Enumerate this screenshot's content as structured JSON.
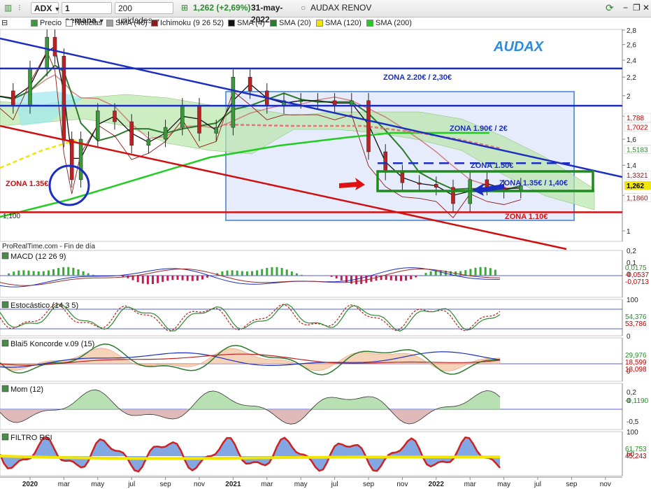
{
  "toolbar": {
    "ticker": "ADX",
    "timeframe": "1 semana",
    "units": "200 unidades",
    "price_change": "1,262 (+2,69%)",
    "date": "31-may-2022",
    "instrument": "AUDAX RENOV"
  },
  "legend": [
    {
      "label": "Precio",
      "color": "#3a9a3a",
      "icon": "candles-icon"
    },
    {
      "label": "Noticias",
      "color": "#ffffff",
      "icon": "news-icon"
    },
    {
      "label": "SMA (40)",
      "color": "#a0a0a0",
      "icon": "line-icon"
    },
    {
      "label": "Ichimoku (9 26 52)",
      "color": "#8b1a1a",
      "icon": "line-icon"
    },
    {
      "label": "SMA (4)",
      "color": "#111111",
      "icon": "line-icon"
    },
    {
      "label": "SMA (20)",
      "color": "#2d7a2d",
      "icon": "line-icon"
    },
    {
      "label": "SMA (120)",
      "color": "#f2e600",
      "icon": "line-icon"
    },
    {
      "label": "SMA (200)",
      "color": "#22cc22",
      "icon": "line-icon"
    }
  ],
  "chart_data": [
    {
      "type": "candlestick",
      "title": "AUDAX",
      "source": "ProRealTime.com - Fin de día",
      "x": [
        "2020-01",
        "2020-03",
        "2020-05",
        "2020-07",
        "2020-09",
        "2020-11",
        "2021-01",
        "2021-03",
        "2021-05",
        "2021-07",
        "2021-09",
        "2021-11",
        "2022-01",
        "2022-03",
        "2022-05",
        "2022-07",
        "2022-09",
        "2022-11"
      ],
      "x_tick_labels": [
        "2020",
        "mar",
        "may",
        "jul",
        "sep",
        "nov",
        "2021",
        "mar",
        "may",
        "jul",
        "sep",
        "nov",
        "2022",
        "mar",
        "may",
        "jul",
        "sep",
        "nov"
      ],
      "y_scale": "log",
      "ylim": [
        0.9,
        2.9
      ],
      "y_tick_labels": [
        "2,8",
        "2,6",
        "2,4",
        "2,2",
        "2",
        "1,8",
        "1,6",
        "1,4",
        "1,2",
        "1"
      ],
      "y_ticks": [
        2.8,
        2.6,
        2.4,
        2.2,
        2.0,
        1.8,
        1.6,
        1.4,
        1.2,
        1.0
      ],
      "price_x": [
        "2019-10",
        "2019-11",
        "2019-12",
        "2020-01",
        "2020-02",
        "2020-02-15",
        "2020-03",
        "2020-03-15",
        "2020-04",
        "2020-05",
        "2020-06",
        "2020-07",
        "2020-08",
        "2020-09",
        "2020-10",
        "2020-11",
        "2020-12",
        "2021-01",
        "2021-02",
        "2021-03",
        "2021-04",
        "2021-05",
        "2021-06",
        "2021-07",
        "2021-08",
        "2021-09",
        "2021-10",
        "2021-11",
        "2021-12",
        "2022-01",
        "2022-02",
        "2022-03",
        "2022-04",
        "2022-05",
        "2022-06"
      ],
      "close": [
        1.95,
        2.05,
        1.9,
        2.3,
        2.7,
        2.45,
        1.6,
        1.3,
        1.6,
        1.85,
        1.75,
        1.55,
        1.6,
        1.7,
        1.9,
        1.65,
        1.7,
        2.2,
        2.05,
        1.9,
        1.95,
        1.95,
        1.95,
        1.9,
        1.95,
        1.5,
        1.35,
        1.28,
        1.27,
        1.25,
        1.15,
        1.3,
        1.25,
        1.23,
        1.262
      ],
      "price_tags": [
        {
          "text": "1,788",
          "value": 1.788,
          "bg": "#ffffff",
          "fg": "#c00000"
        },
        {
          "text": "1,7022",
          "value": 1.7022,
          "bg": "#ffffff",
          "fg": "#c00000"
        },
        {
          "text": "1,5183",
          "value": 1.5183,
          "bg": "#ffffff",
          "fg": "#2d8a2d"
        },
        {
          "text": "1,3321",
          "value": 1.3321,
          "bg": "#ffffff",
          "fg": "#8b1a1a"
        },
        {
          "text": "1,262",
          "value": 1.262,
          "bg": "#f2e600",
          "fg": "#000000"
        },
        {
          "text": "1,1860",
          "value": 1.186,
          "bg": "#ffffff",
          "fg": "#8b1a1a"
        }
      ],
      "zones": [
        {
          "text": "ZONA 2.20€ / 2,30€",
          "value": 2.3,
          "color": "#1b2ec0"
        },
        {
          "text": "ZONA 1.90€ / 2€",
          "value": 1.9,
          "color": "#1b2ec0"
        },
        {
          "text": "ZONA 1.50€",
          "value": 1.5,
          "color": "#1b2ec0"
        },
        {
          "text": "ZONA 1.35€ / 1,40€",
          "value": 1.4,
          "color": "#1b2ec0"
        },
        {
          "text": "ZONA 1.10€",
          "value": 1.1,
          "color": "#d01010"
        },
        {
          "text": "ZONA 1.35€",
          "value": 1.35,
          "color": "#d01010"
        }
      ],
      "extra_label": "1,100"
    },
    {
      "type": "area",
      "title": "MACD (12 26 9)",
      "y_tick_labels": [
        "0,2",
        "0,1",
        "0"
      ],
      "y_ticks": [
        0.2,
        0.1,
        0
      ],
      "ylim": [
        -0.2,
        0.2
      ],
      "last_values": [
        "0,0175",
        "-0,0537",
        "-0,0713"
      ]
    },
    {
      "type": "line",
      "title": "Estocástico (14 3 5)",
      "y_tick_labels": [
        "100",
        "0"
      ],
      "y_ticks": [
        100,
        0
      ],
      "ylim": [
        0,
        100
      ],
      "last_values": [
        "54,376",
        "53,786"
      ]
    },
    {
      "type": "area",
      "title": "Blai5 Koncorde v.09 (15)",
      "y_tick_labels": [
        "0"
      ],
      "y_ticks": [
        0
      ],
      "last_values": [
        "29,976",
        "18,599",
        "18,098"
      ]
    },
    {
      "type": "area",
      "title": "Mom (12)",
      "y_tick_labels": [
        "0,2",
        "0",
        "-0,5"
      ],
      "y_ticks": [
        0.2,
        0,
        -0.5
      ],
      "ylim": [
        -0.7,
        0.4
      ],
      "last_values": [
        "-0,1190"
      ]
    },
    {
      "type": "line",
      "title": "FILTRO RSI",
      "y_tick_labels": [
        "100",
        "50"
      ],
      "y_ticks": [
        100,
        50
      ],
      "ylim": [
        0,
        100
      ],
      "last_values": [
        "61,753",
        "45,243"
      ]
    }
  ]
}
